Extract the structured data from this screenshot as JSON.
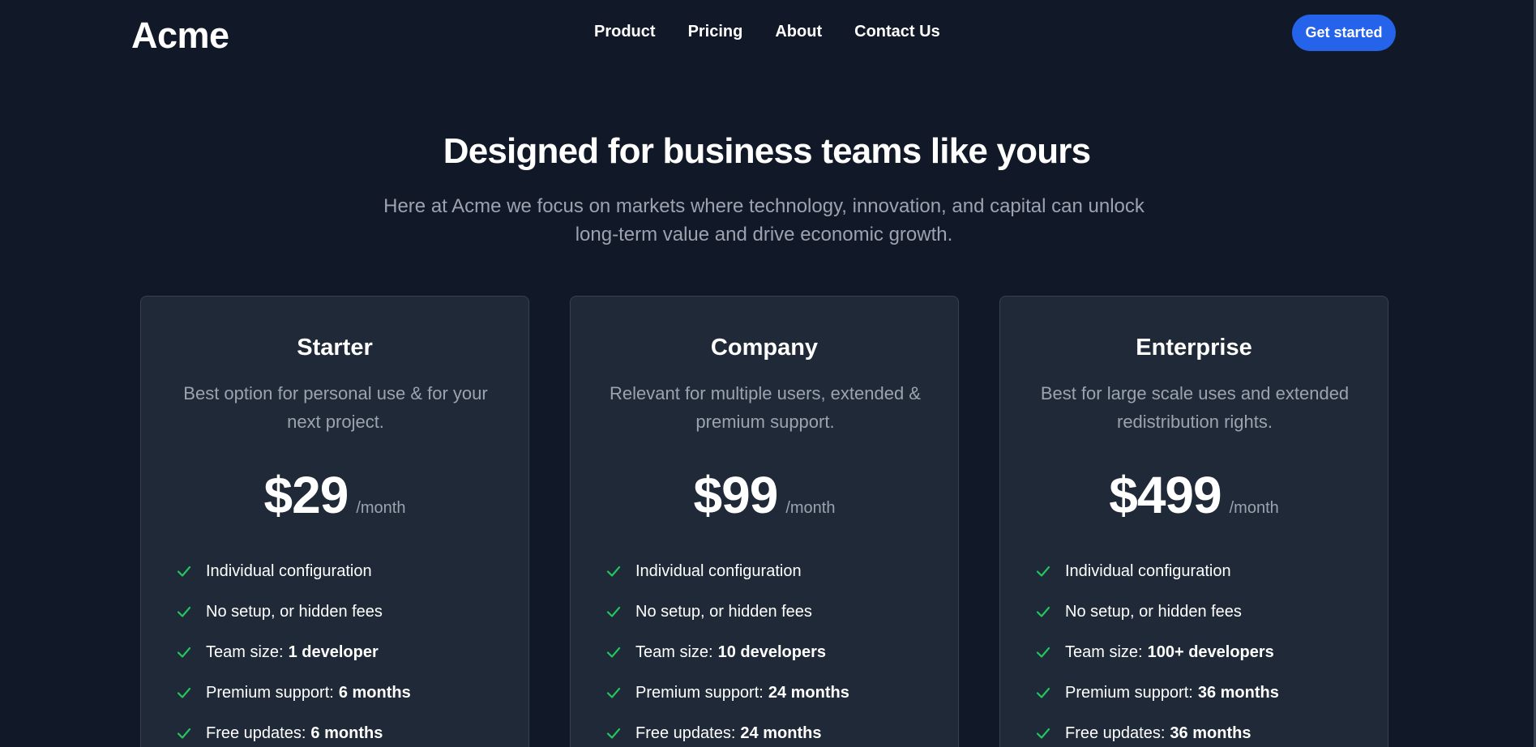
{
  "nav": {
    "logo": "Acme",
    "links": [
      "Product",
      "Pricing",
      "About",
      "Contact Us"
    ],
    "cta_label": "Get started"
  },
  "hero": {
    "title": "Designed for business teams like yours",
    "subtitle_line1": "Here at Acme we focus on markets where technology, innovation, and capital can unlock",
    "subtitle_line2": "long-term value and drive economic growth."
  },
  "plans": [
    {
      "name": "Starter",
      "desc_line1": "Best option for personal use & for your",
      "desc_line2": "next project.",
      "price": "$29",
      "period": "/month",
      "features": [
        {
          "label": "Individual configuration",
          "value": ""
        },
        {
          "label": "No setup, or hidden fees",
          "value": ""
        },
        {
          "label": "Team size:",
          "value": "1 developer"
        },
        {
          "label": "Premium support:",
          "value": "6 months"
        },
        {
          "label": "Free updates:",
          "value": "6 months"
        }
      ]
    },
    {
      "name": "Company",
      "desc_line1": "Relevant for multiple users, extended &",
      "desc_line2": "premium support.",
      "price": "$99",
      "period": "/month",
      "features": [
        {
          "label": "Individual configuration",
          "value": ""
        },
        {
          "label": "No setup, or hidden fees",
          "value": ""
        },
        {
          "label": "Team size:",
          "value": "10 developers"
        },
        {
          "label": "Premium support:",
          "value": "24 months"
        },
        {
          "label": "Free updates:",
          "value": "24 months"
        }
      ]
    },
    {
      "name": "Enterprise",
      "desc_line1": "Best for large scale uses and extended",
      "desc_line2": "redistribution rights.",
      "price": "$499",
      "period": "/month",
      "features": [
        {
          "label": "Individual configuration",
          "value": ""
        },
        {
          "label": "No setup, or hidden fees",
          "value": ""
        },
        {
          "label": "Team size:",
          "value": "100+ developers"
        },
        {
          "label": "Premium support:",
          "value": "36 months"
        },
        {
          "label": "Free updates:",
          "value": "36 months"
        }
      ]
    }
  ],
  "colors": {
    "background": "#111827",
    "card": "#1f2937",
    "accent": "#2563eb",
    "check": "#22c55e",
    "muted_text": "#9ca3af"
  },
  "icons": {
    "feature": "check-icon"
  }
}
